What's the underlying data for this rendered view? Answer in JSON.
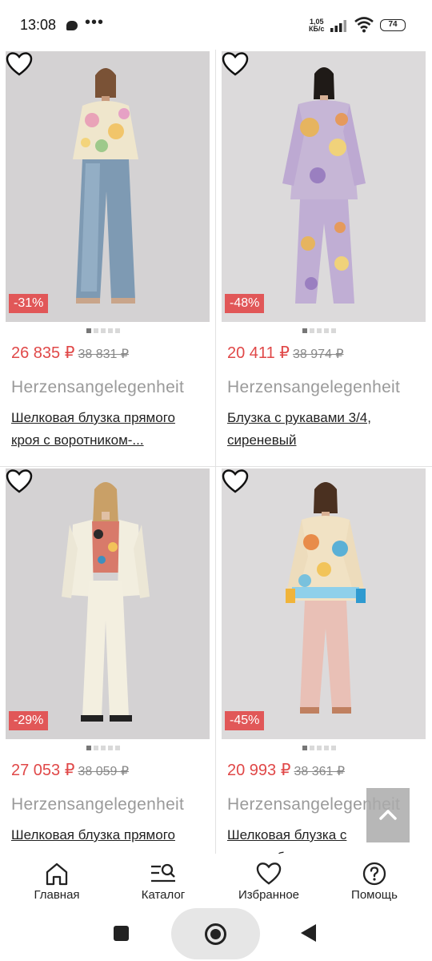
{
  "status_bar": {
    "time": "13:08",
    "dots": "•••",
    "speed_value": "1,05",
    "speed_unit": "КБ/с",
    "battery": "74"
  },
  "products": [
    {
      "discount": "-31%",
      "price": "26 835 ₽",
      "old_price": "38 831 ₽",
      "brand": "Herzensangelegenheit",
      "title": "Шелковая блузка прямого кроя с воротником-...",
      "image": "woman in floral silk blouse and blue wide-leg jeans",
      "image_index": 1,
      "image_count": 5
    },
    {
      "discount": "-48%",
      "price": "20 411 ₽",
      "old_price": "38 974 ₽",
      "brand": "Herzensangelegenheit",
      "title": "Блузка с рукавами 3/4, сиреневый",
      "image": "woman in lilac paisley print silk set",
      "image_index": 1,
      "image_count": 5
    },
    {
      "discount": "-29%",
      "price": "27 053 ₽",
      "old_price": "38 059 ₽",
      "brand": "Herzensangelegenheit",
      "title": "Шелковая блузка прямого кроя с воротником-...",
      "image": "woman in cream blazer and trousers with leopard print blouse",
      "image_index": 1,
      "image_count": 5
    },
    {
      "discount": "-45%",
      "price": "20 993 ₽",
      "old_price": "38 361 ₽",
      "brand": "Herzensangelegenheit",
      "title": "Шелковая блузка с туникообразным ...",
      "image": "woman in printed silk tunic blouse and pink trousers",
      "image_index": 1,
      "image_count": 5
    }
  ],
  "bottom_nav": [
    {
      "label": "Главная",
      "icon": "home-icon"
    },
    {
      "label": "Каталог",
      "icon": "catalog-search-icon"
    },
    {
      "label": "Избранное",
      "icon": "heart-icon"
    },
    {
      "label": "Помощь",
      "icon": "help-icon"
    }
  ],
  "colors": {
    "price": "#e04848",
    "discount_badge": "#e15758",
    "brand_text": "#9a9a9a"
  }
}
